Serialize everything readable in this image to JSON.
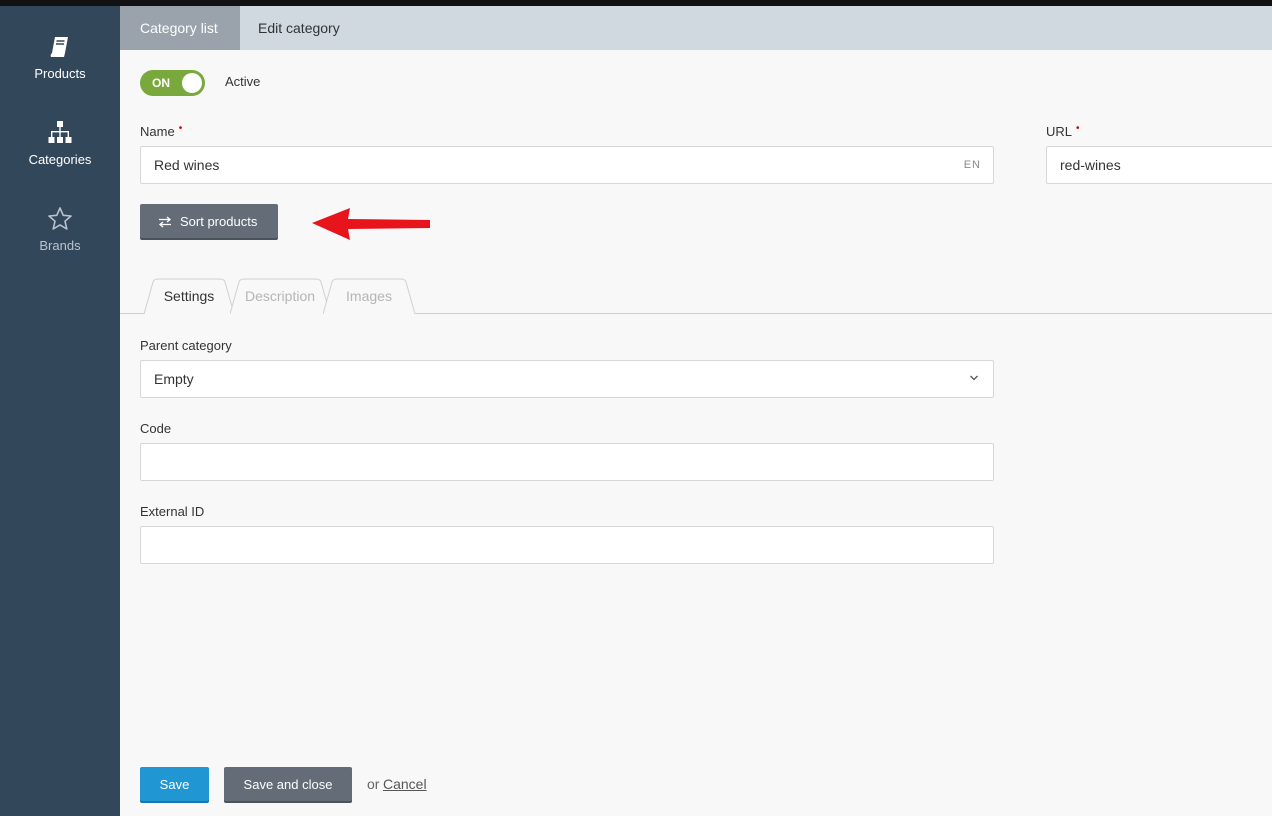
{
  "sidebar": {
    "items": [
      {
        "label": "Products",
        "icon": "book-icon"
      },
      {
        "label": "Categories",
        "icon": "sitemap-icon"
      },
      {
        "label": "Brands",
        "icon": "star-icon"
      }
    ]
  },
  "breadcrumb": {
    "parent": "Category list",
    "current": "Edit category"
  },
  "status": {
    "toggle_text": "ON",
    "label": "Active"
  },
  "form": {
    "name_label": "Name",
    "name_value": "Red wines",
    "name_lang": "EN",
    "url_label": "URL",
    "url_value": "red-wines",
    "required_mark": "•",
    "sort_button": "Sort products"
  },
  "tabs": [
    {
      "label": "Settings",
      "active": true
    },
    {
      "label": "Description",
      "active": false
    },
    {
      "label": "Images",
      "active": false
    }
  ],
  "settings": {
    "parent_label": "Parent category",
    "parent_value": "Empty",
    "code_label": "Code",
    "code_value": "",
    "external_id_label": "External ID",
    "external_id_value": ""
  },
  "footer": {
    "save": "Save",
    "save_close": "Save and close",
    "or": "or",
    "cancel": "Cancel"
  },
  "colors": {
    "sidebar": "#33475b",
    "toggle_on": "#79a83d",
    "save_button": "#2096d3",
    "secondary_button": "#646d77",
    "annotation_arrow": "#e8141b"
  }
}
